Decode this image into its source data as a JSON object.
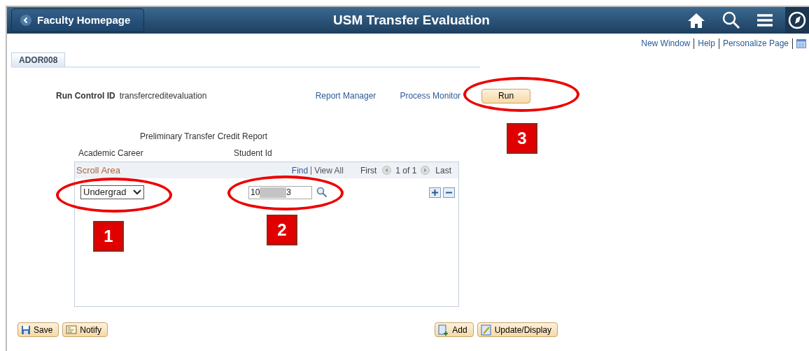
{
  "header": {
    "back_button": "Faculty Homepage",
    "title": "USM Transfer Evaluation"
  },
  "page_links": [
    "New Window",
    "Help",
    "Personalize Page"
  ],
  "tabs": [
    {
      "label": "ADOR008",
      "selected": true
    }
  ],
  "run_control": {
    "label": "Run Control ID",
    "value": "transfercreditevaluation"
  },
  "links": [
    "Report Manager",
    "Process Monitor"
  ],
  "run_button": "Run",
  "section_title": "Preliminary Transfer Credit Report",
  "columns": [
    "Academic Career",
    "Student Id"
  ],
  "scroll_area": {
    "title": "Scroll Area",
    "find": "Find",
    "view_all": "View All",
    "first": "First",
    "count": "1 of 1",
    "last": "Last"
  },
  "row": {
    "career": "Undergrad",
    "student_id_start": "10",
    "student_id_end": "3",
    "redacted": true
  },
  "footer_buttons": [
    {
      "label": "Save",
      "kind": "save"
    },
    {
      "label": "Notify",
      "kind": "notify"
    }
  ],
  "action_buttons": [
    {
      "label": "Add",
      "kind": "add"
    },
    {
      "label": "Update/Display",
      "kind": "update"
    }
  ],
  "annotations": [
    {
      "number": "1"
    },
    {
      "number": "2"
    },
    {
      "number": "3"
    }
  ]
}
